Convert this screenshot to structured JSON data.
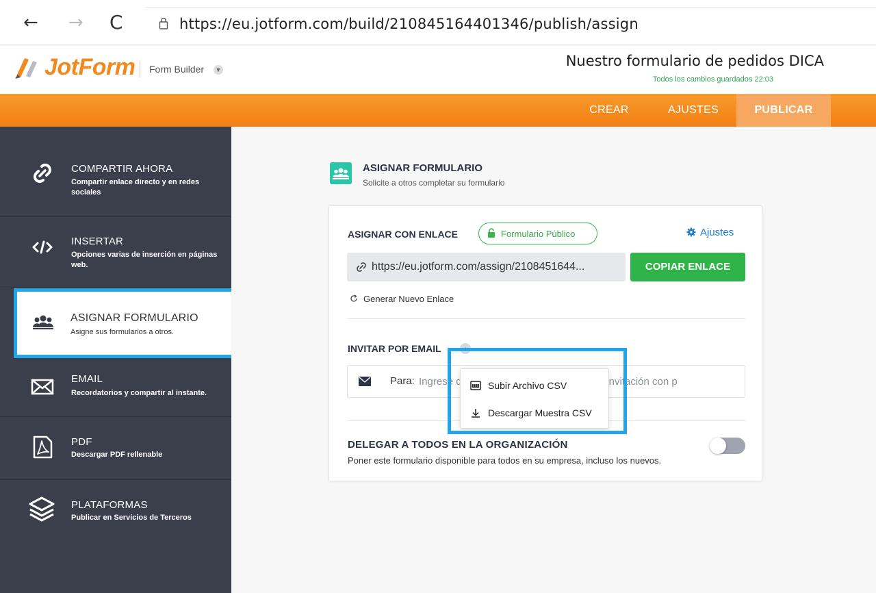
{
  "browser": {
    "url": "https://eu.jotform.com/build/210845164401346/publish/assign",
    "back_glyph": "←",
    "forward_glyph": "→",
    "reload_glyph": "C"
  },
  "header": {
    "logo_text": "JotForm",
    "builder_label": "Form Builder",
    "form_title": "Nuestro formulario de pedidos DICA",
    "save_status": "Todos los cambios guardados 22:03",
    "accent_color": "#f27f14"
  },
  "tabs": {
    "crear": "CREAR",
    "ajustes": "AJUSTES",
    "publicar": "PUBLICAR"
  },
  "sidebar": {
    "items": [
      {
        "title": "COMPARTIR AHORA",
        "desc": "Compartir enlace directo y en redes sociales",
        "icon": "link-icon"
      },
      {
        "title": "INSERTAR",
        "desc": "Opciones varias de inserción en páginas web.",
        "icon": "code-icon"
      },
      {
        "title": "ASIGNAR FORMULARIO",
        "desc": "Asigne sus formularios a otros.",
        "icon": "users-icon",
        "active": true
      },
      {
        "title": "EMAIL",
        "desc": "Recordatorios y compartir al instante.",
        "icon": "envelope-icon"
      },
      {
        "title": "PDF",
        "desc": "Descargar PDF rellenable",
        "icon": "pdf-icon"
      },
      {
        "title": "PLATAFORMAS",
        "desc": "Publicar en Servicios de Terceros",
        "icon": "layers-icon"
      }
    ]
  },
  "main": {
    "section_title": "ASIGNAR FORMULARIO",
    "section_subtitle": "Solicite a otros completar su formulario",
    "assign_link_label": "ASIGNAR CON ENLACE",
    "public_badge": "Formulario Público",
    "settings_link": "Ajustes",
    "link_value": "https://eu.jotform.com/assign/2108451644...",
    "copy_button": "COPIAR ENLACE",
    "regenerate_link": "Generar Nuevo Enlace",
    "invite_label": "INVITAR POR EMAIL",
    "to_label": "Para:",
    "email_placeholder": "Ingrese direcciones de email para enviar invitación con p",
    "delegate_title": "DELEGAR A TODOS EN LA ORGANIZACIÓN",
    "delegate_desc": "Poner este formulario disponible para todos en su empresa, incluso los nuevos.",
    "delegate_enabled": false
  },
  "dropdown": {
    "upload_csv": "Subir Archivo CSV",
    "download_csv": "Descargar Muestra CSV"
  },
  "colors": {
    "highlight": "#23a5e8",
    "green": "#2fb44a",
    "teal": "#2bc5a7",
    "sidebar_bg": "#3b3f4b"
  }
}
